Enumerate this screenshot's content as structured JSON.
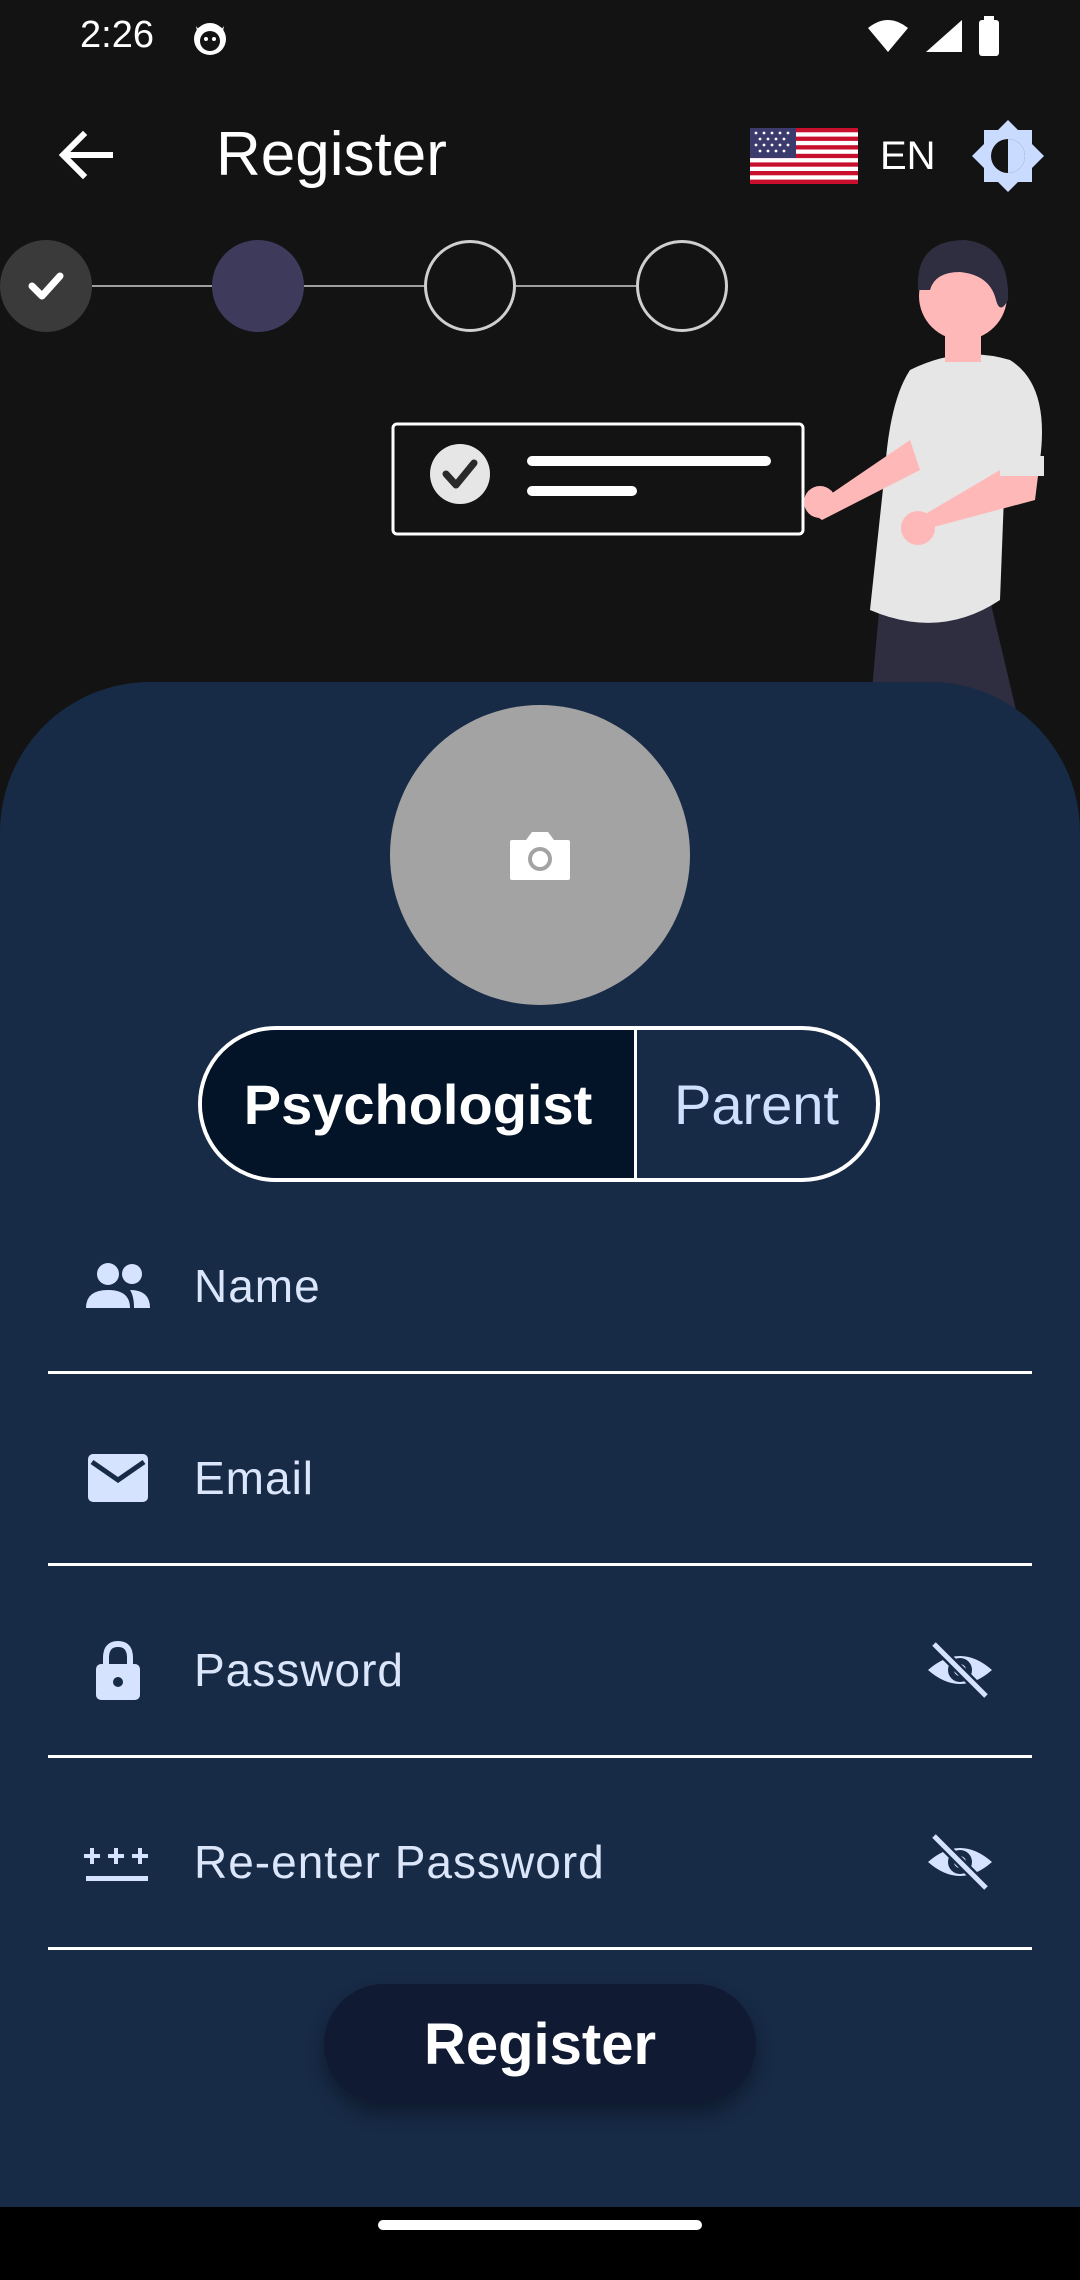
{
  "status_bar": {
    "time": "2:26"
  },
  "app_bar": {
    "title": "Register",
    "language_code": "EN"
  },
  "stepper": {
    "steps": [
      "completed",
      "current",
      "pending",
      "pending"
    ]
  },
  "role_toggle": {
    "options": [
      "Psychologist",
      "Parent"
    ],
    "selected": "Psychologist"
  },
  "form": {
    "name_label": "Name",
    "email_label": "Email",
    "password_label": "Password",
    "reenter_password_label": "Re-enter Password"
  },
  "register_button": {
    "label": "Register"
  },
  "colors": {
    "background": "#131313",
    "sheet": "#172a46",
    "selected_toggle": "#031428",
    "button": "#111a33",
    "step_current": "#3d3a5c"
  }
}
